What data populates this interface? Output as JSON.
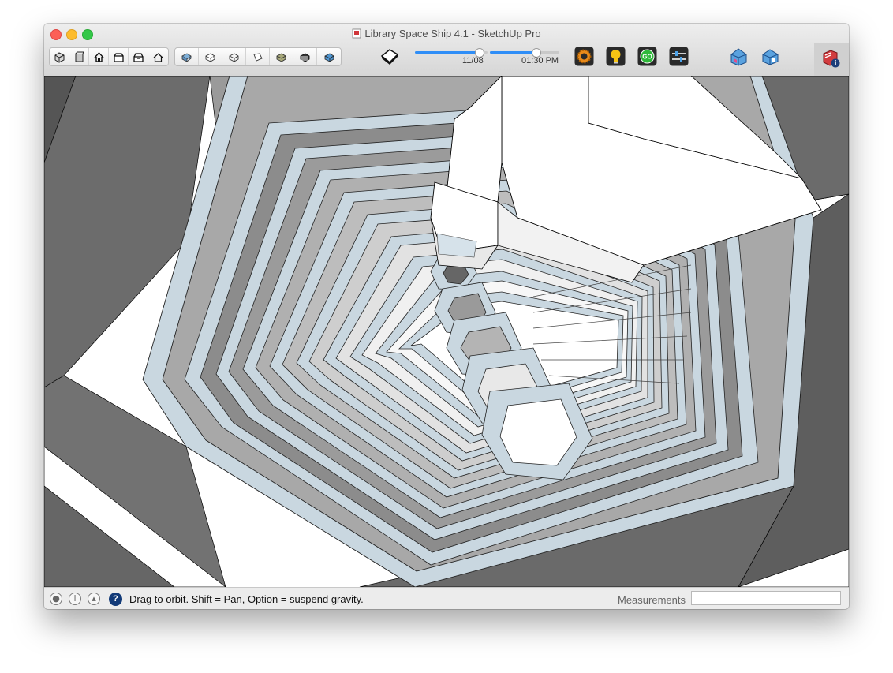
{
  "window": {
    "title": "Library Space Ship 4.1 - SketchUp Pro"
  },
  "toolbar": {
    "camera_tools": [
      "iso-view",
      "top-view",
      "front-view",
      "right-view",
      "back-view",
      "left-view"
    ],
    "style_tools": [
      "x-ray",
      "back-edges",
      "wireframe",
      "hidden-line",
      "shaded",
      "shaded-with-textures",
      "monochrome"
    ],
    "shadow_toggle": "shadows-icon",
    "date_value": "11/08",
    "time_value": "01:30 PM",
    "date_fraction": 0.88,
    "time_fraction": 0.66,
    "accent_color": "#2f8ef7",
    "extensions": [
      "gear-render-icon",
      "lightbulb-icon",
      "go-icon",
      "sliders-icon",
      "warehouse-icon",
      "extension-warehouse-icon",
      "model-info-icon"
    ]
  },
  "statusbar": {
    "icons": [
      "geo-location-icon",
      "credits-icon",
      "user-icon",
      "help-icon"
    ],
    "help_glyph": "?",
    "message": "Drag to orbit. Shift = Pan, Option = suspend gravity.",
    "measurements_label": "Measurements",
    "measurements_value": ""
  }
}
